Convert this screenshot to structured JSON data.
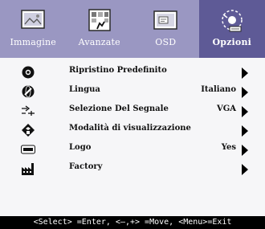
{
  "tabs": [
    {
      "label": "Immagine",
      "icon": "picture-icon",
      "active": false
    },
    {
      "label": "Avanzate",
      "icon": "advanced-settings-icon",
      "active": false
    },
    {
      "label": "OSD",
      "icon": "osd-window-icon",
      "active": false
    },
    {
      "label": "Opzioni",
      "icon": "options-icon",
      "active": true
    }
  ],
  "menu": [
    {
      "label": "Ripristino Predefinito",
      "value": "",
      "icon": "reset-icon",
      "arrow": true
    },
    {
      "label": "Lingua",
      "value": "Italiano",
      "icon": "language-icon",
      "arrow": true
    },
    {
      "label": "Selezione Del Segnale",
      "value": "VGA",
      "icon": "signal-input-icon",
      "arrow": true
    },
    {
      "label": "Modalità di visualizzazione",
      "value": "",
      "icon": "display-mode-icon",
      "arrow": true
    },
    {
      "label": "Logo",
      "value": "Yes",
      "icon": "logo-icon",
      "arrow": true
    },
    {
      "label": "Factory",
      "value": "",
      "icon": "factory-icon",
      "arrow": true
    }
  ],
  "status_bar": {
    "text": "<Select> =Enter, <–,+> =Move, <Menu>=Exit"
  },
  "colors": {
    "tab_bar": "#9a97c2",
    "tab_active": "#5e5a96",
    "background": "#f6f6f8",
    "status_bar": "#000000"
  }
}
